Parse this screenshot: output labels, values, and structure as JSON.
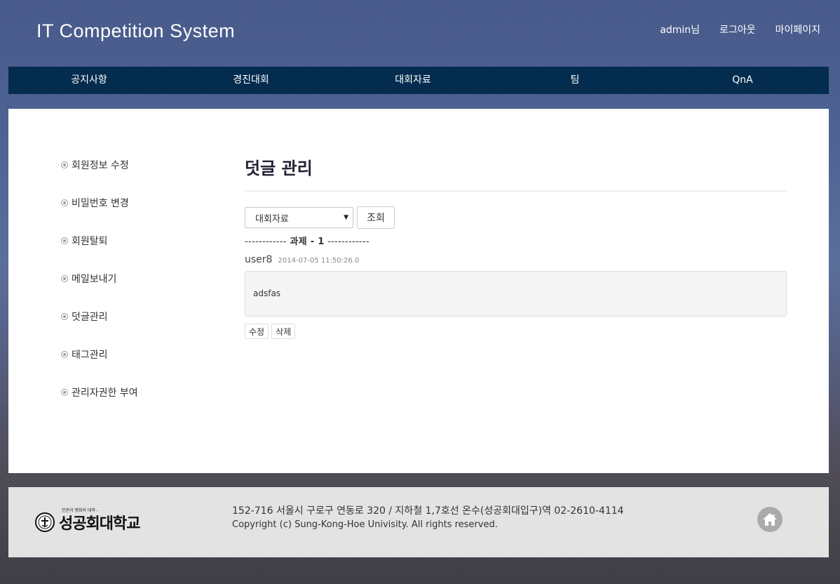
{
  "header": {
    "site_title": "IT Competition System",
    "user_label": "admin님",
    "logout_label": "로그아웃",
    "mypage_label": "마이페이지"
  },
  "nav": {
    "items": [
      {
        "label": "공지사항"
      },
      {
        "label": "경진대회"
      },
      {
        "label": "대회자료"
      },
      {
        "label": "팀"
      },
      {
        "label": "QnA"
      }
    ]
  },
  "sidebar": {
    "items": [
      {
        "label": "회원정보 수정"
      },
      {
        "label": "비밀번호 변경"
      },
      {
        "label": "회원탈퇴"
      },
      {
        "label": "메일보내기"
      },
      {
        "label": "덧글관리"
      },
      {
        "label": "태그관리"
      },
      {
        "label": "관리자권한 부여"
      }
    ]
  },
  "content": {
    "page_title": "덧글 관리",
    "filter": {
      "selected": "대회자료",
      "search_label": "조회"
    },
    "section": {
      "dashes_left": "------------",
      "title": "과제 - 1",
      "dashes_right": "------------"
    },
    "comment": {
      "user": "user8",
      "date": "2014-07-05 11:50:26.0",
      "body": "adsfas",
      "edit_label": "수정",
      "delete_label": "삭제"
    }
  },
  "footer": {
    "logo_tagline": "인권과 평화의 대학 -",
    "logo_text": "성공회대학교",
    "address": "152-716 서울시 구로구 연동로 320 / 지하철 1,7호선 온수(성공회대입구)역 02-2610-4114",
    "copyright": "Copyright (c) Sung-Kong-Hoe Univisity. All rights reserved."
  },
  "colors": {
    "navbar": "#032c4e",
    "panel": "#ffffff",
    "footer": "#e3e3e3"
  }
}
